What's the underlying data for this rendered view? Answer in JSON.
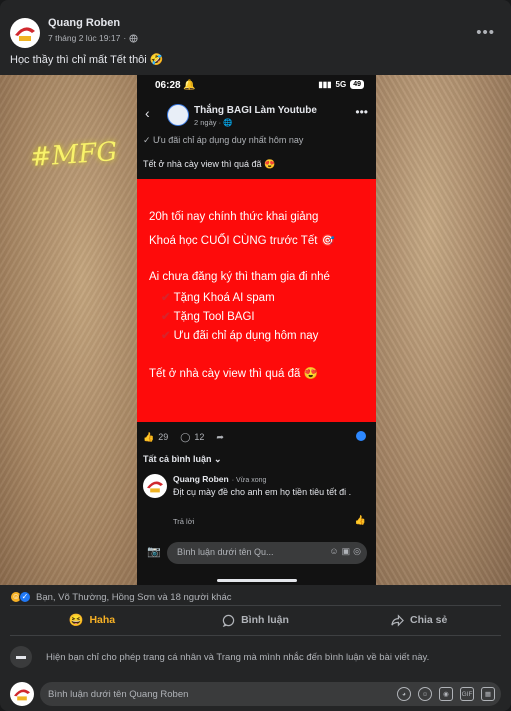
{
  "post": {
    "author": "Quang Roben",
    "timestamp": "7 tháng 2 lúc 19:17",
    "privacy_icon": "globe-icon",
    "more_icon": "ellipsis-icon",
    "caption": "Học thầy thì chỉ mất Tết thôi 🤣"
  },
  "media": {
    "watermark": "#MFG",
    "phone": {
      "status_time": "06:28 🔔",
      "status_right": "5G",
      "battery": "49",
      "post_author": "Thắng BAGI Làm Youtube",
      "post_time": "2 ngày · 🌐",
      "line_top": "✓ Ưu đãi chỉ áp dụng duy nhất hôm nay",
      "line_tet": "Tết ở nhà cày view thì quá đã 😍",
      "red_lines": {
        "l1": "20h tối nay chính thức khai giảng",
        "l2": "Khoá học CUỐI CÙNG trước Tết 🎯",
        "l3": "Ai chưa đăng ký thì tham gia đi nhé",
        "c1": "Tặng Khoá AI spam",
        "c2": "Tặng Tool BAGI",
        "c3": "Ưu đãi chỉ áp dụng  hôm nay",
        "l4": "Tết ở nhà cày view thì quá đã 😍"
      },
      "likes": "29",
      "comments": "12",
      "all_comments": "Tất cả bình luận ⌄",
      "comment": {
        "author": "Quang Roben",
        "time": "· Vừa xong",
        "text": "Địt cụ mày đề cho anh em họ tiền tiêu tết đi .",
        "reply": "Trả lời"
      },
      "input_placeholder": "Bình luận dưới tên Qu..."
    }
  },
  "reactions": {
    "summary": "Bạn, Võ Thường, Hồng Sơn và 18 người khác"
  },
  "actions": {
    "haha": "Haha",
    "comment": "Bình luận",
    "share": "Chia sẻ"
  },
  "notice": "Hiện bạn chỉ cho phép trang cá nhân và Trang mà mình nhắc đến bình luận về bài viết này.",
  "composer": {
    "placeholder": "Bình luận dưới tên Quang Roben"
  },
  "colors": {
    "accent_haha": "#f7b125",
    "red_box": "#fe0b0b",
    "background": "#242526"
  }
}
